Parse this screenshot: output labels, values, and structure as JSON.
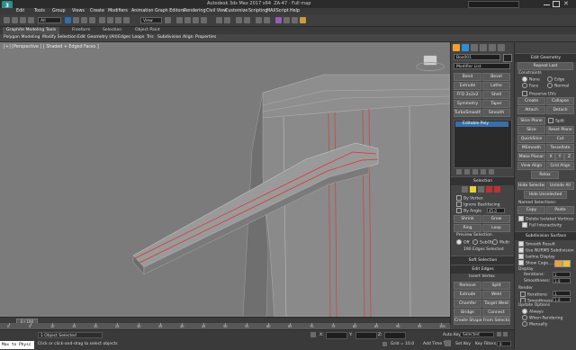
{
  "app": {
    "title": "Autodesk 3ds Max 2017 x64",
    "file": "ZA-47 - Full map",
    "logo": "3ds-max-logo"
  },
  "menu": [
    "Edit",
    "Tools",
    "Group",
    "Views",
    "Create",
    "Modifiers",
    "Animation",
    "Graph Editors",
    "Rendering",
    "Civil View",
    "Customize",
    "Scripting",
    "MAXScript",
    "Help"
  ],
  "toolbar": {
    "selection_filter": "All",
    "view_dropdown": "View"
  },
  "ribbon": {
    "tabs": [
      "Graphite Modeling Tools",
      "Freeform",
      "Selection",
      "Object Paint"
    ],
    "subtabs": [
      "Polygon Modeling",
      "Modify Selection",
      "Edit",
      "Geometry (All)",
      "Edges",
      "Loops",
      "Tris",
      "Subdivision",
      "Align",
      "Properties"
    ]
  },
  "viewport": {
    "label": "[+] [Perspective ] [ Shaded + Edged Faces ]"
  },
  "command_panel": {
    "object_name": "Box001",
    "modifier_list_label": "Modifier List",
    "modifier_buttons": [
      "Bend",
      "Bevel",
      "Extrude",
      "Lathe",
      "FFD 2x2x2",
      "Shell",
      "Symmetry",
      "Taper",
      "TurboSmooth",
      "Smooth"
    ],
    "stack_item": "Editable Poly",
    "selection": {
      "header": "Selection",
      "by_vertex": "By Vertex",
      "ignore_backfacing": "Ignore Backfacing",
      "by_angle": "By Angle",
      "angle_value": "45.0",
      "shrink": "Shrink",
      "grow": "Grow",
      "ring": "Ring",
      "loop": "Loop",
      "preview_selection": "Preview Selection",
      "preview_options": [
        "Off",
        "SubObj",
        "Multi"
      ],
      "status": "190 Edges Selected"
    },
    "soft_selection": "Soft Selection",
    "edit_edges": {
      "header": "Edit Edges",
      "insert_vertex": "Insert Vertex",
      "buttons": [
        "Remove",
        "Split",
        "Extrude",
        "Weld",
        "Chamfer",
        "Target Weld",
        "Bridge",
        "Connect"
      ],
      "create_shape": "Create Shape From Selection",
      "weight_label": "Weight:",
      "weight_value": "1.0",
      "crease_label": "Crease:",
      "crease_value": "0.0"
    }
  },
  "right_panel": {
    "edit_geometry": {
      "header": "Edit Geometry",
      "repeat_last": "Repeat Last",
      "constraints": "Constraints",
      "constraint_options": [
        "None",
        "Edge",
        "Face",
        "Normal"
      ],
      "preserve_uvs": "Preserve UVs",
      "buttons": [
        "Create",
        "Collapse",
        "Attach",
        "Detach",
        "Slice Plane",
        "Split",
        "Reset Plane",
        "Slice",
        "QuickSlice",
        "Cut",
        "MSmooth",
        "Tessellate",
        "Make Planar",
        "X",
        "Y",
        "Z",
        "View Align",
        "Grid Align",
        "Relax",
        "Hide Selected",
        "Unhide All",
        "Hide Unselected"
      ],
      "named_selections": "Named Selections:",
      "copy": "Copy",
      "paste": "Paste",
      "delete_isolated": "Delete Isolated Vertices",
      "full_interactivity": "Full Interactivity"
    },
    "subdivision_surface": {
      "header": "Subdivision Surface",
      "smooth_result": "Smooth Result",
      "use_nurms": "Use NURMS Subdivision",
      "isoline_display": "Isoline Display",
      "show_cage": "Show Cage......",
      "display": "Display",
      "iterations_label": "Iterations:",
      "iterations_value": "1",
      "smoothness_label": "Smoothness:",
      "smoothness_value": "1.0",
      "render": "Render",
      "separate_by": "Separate By",
      "smoothing_groups": "Smoothing Groups",
      "materials": "Materials",
      "update_options": "Update Options",
      "always": "Always",
      "when_rendering": "When Rendering",
      "manually": "Manually"
    }
  },
  "timeline": {
    "frame": "0 / 100",
    "ticks": [
      "0",
      "5",
      "10",
      "15",
      "20",
      "25",
      "30",
      "35",
      "40",
      "45",
      "50",
      "55",
      "60",
      "65",
      "70",
      "75",
      "80",
      "85",
      "90",
      "95",
      "100"
    ]
  },
  "status": {
    "script_listener": "Max to Physc",
    "objects_selected": "1 Object Selected",
    "prompt": "Click or click-and-drag to select objects",
    "x_label": "X:",
    "y_label": "Y:",
    "z_label": "Z:",
    "grid": "Grid = 10.0",
    "add_time_tag": "Add Time Tag",
    "auto_key": "Auto Key",
    "set_key": "Set Key",
    "selected": "Selected",
    "key_filters": "Key Filters...",
    "frame_value": "0"
  },
  "colors": {
    "accent": "#f0a030",
    "selected_edge": "#e03030",
    "viewport_bg": "#7b7b7b",
    "panel_bg": "#444444"
  }
}
